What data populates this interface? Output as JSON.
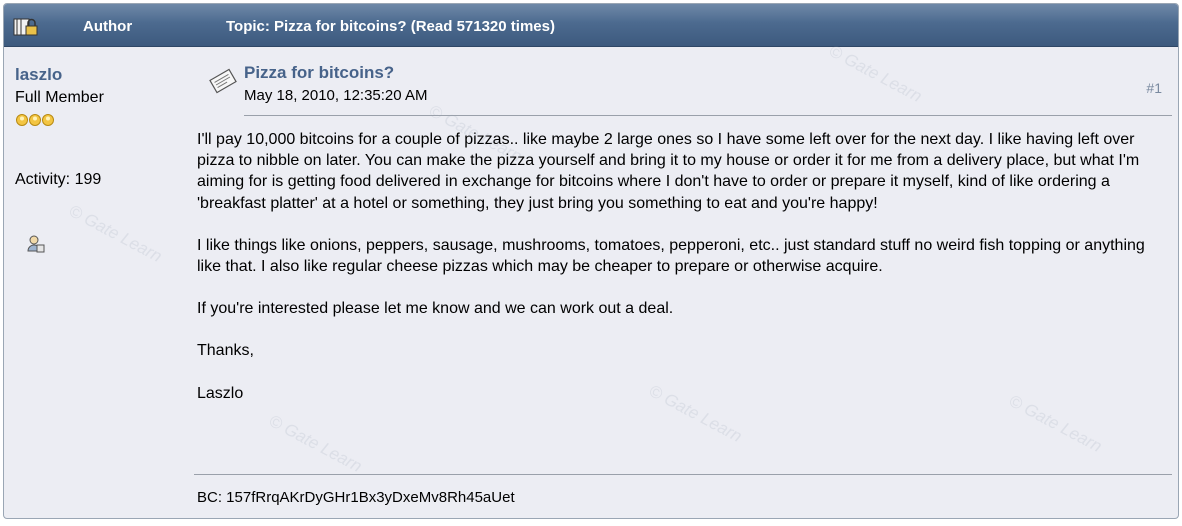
{
  "header": {
    "author_label": "Author",
    "topic_label": "Topic: Pizza for bitcoins?  (Read 571320 times)"
  },
  "author": {
    "username": "laszlo",
    "rank": "Full Member",
    "activity": "Activity: 199",
    "icons": [
      "lock-icon",
      "rank-stars-icon",
      "profile-icon"
    ]
  },
  "post": {
    "title": "Pizza for bitcoins?",
    "date": "May 18, 2010, 12:35:20 AM",
    "number": "#1",
    "paragraphs": [
      "I'll pay 10,000 bitcoins for a couple of pizzas.. like maybe 2 large ones so I have some left over for the next day.  I like having left over pizza to nibble on later.  You can make the pizza yourself and bring it to my house or order it for me from a delivery place, but what I'm aiming for is getting food delivered in exchange for bitcoins where I don't have to order or prepare it myself, kind of like ordering a 'breakfast platter' at a hotel or something, they just bring you something to eat and you're happy!",
      "I like things like onions, peppers, sausage, mushrooms, tomatoes, pepperoni, etc.. just standard stuff no weird fish topping or anything like that.  I also like regular cheese pizzas which may be cheaper to prepare or otherwise acquire.",
      "If you're interested please let me know and we can work out a deal."
    ],
    "signoff_line1": "Thanks,",
    "signoff_line2": "Laszlo",
    "signature": "BC: 157fRrqAKrDyGHr1Bx3yDxeMv8Rh45aUet"
  },
  "colors": {
    "header_bg": "#4c6a8f",
    "link": "#47638a",
    "panel_bg": "#ecedf3"
  }
}
